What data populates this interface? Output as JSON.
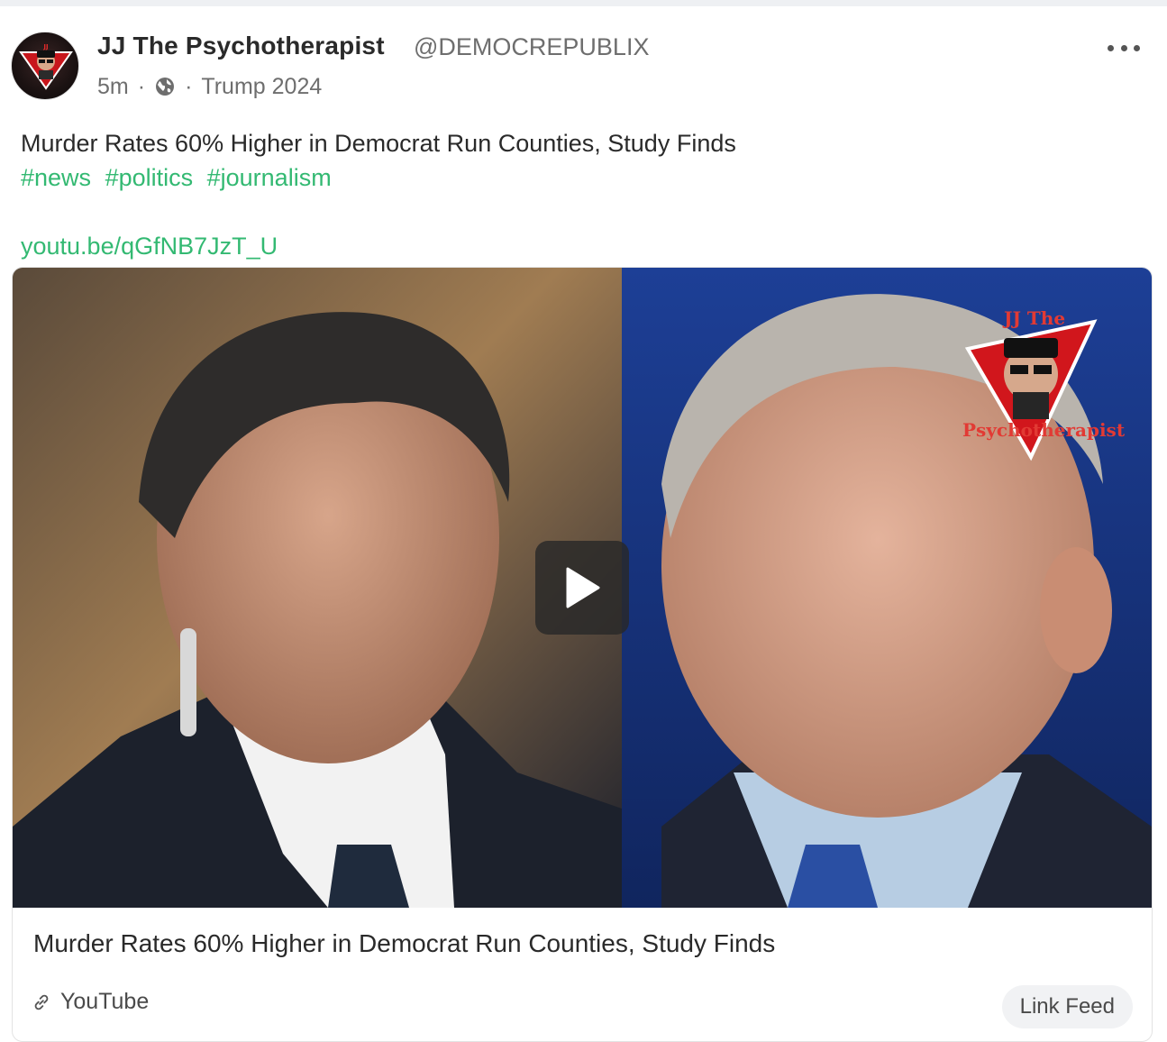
{
  "author": {
    "name": "JJ The Psychotherapist",
    "handle": "@DEMOCREPUBLIX",
    "avatar_icon": "profile-avatar-icon"
  },
  "meta": {
    "time": "5m",
    "separator": "·",
    "visibility_icon": "globe-icon",
    "group": "Trump 2024"
  },
  "menu_icon": "more-options-icon",
  "post": {
    "text": "Murder Rates 60% Higher in Democrat Run Counties, Study Finds",
    "hashtags": [
      "#news",
      "#politics",
      "#journalism"
    ],
    "link": "youtu.be/qGfNB7JzT_U"
  },
  "card": {
    "title": "Murder Rates 60% Higher in Democrat Run Counties, Study Finds",
    "source": "YouTube",
    "source_icon": "link-icon",
    "action_label": "Link Feed",
    "play_icon": "play-icon",
    "watermark_text_top": "JJ The",
    "watermark_text_bottom": "Psychotherapist"
  },
  "colors": {
    "accent": "#33b972",
    "right_bg": "#1c3d8f"
  }
}
